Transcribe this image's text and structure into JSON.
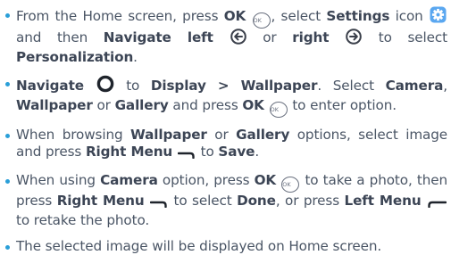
{
  "steps": [
    {
      "t1": "From the Home screen, press ",
      "ok": "OK",
      "ok_icon_text": "OK",
      "t2": ", select ",
      "settings": "Settings",
      "t3": " icon ",
      "t4": " and then ",
      "nav_left": "Navigate left",
      "t5": " or ",
      "right": "right",
      "t6": " to select ",
      "personalization": "Personalization",
      "t7": "."
    },
    {
      "navigate": "Navigate",
      "t1": " to ",
      "display_wallpaper": "Display > Wallpaper",
      "t2": ". Select ",
      "camera": "Camera",
      "t3": ", ",
      "wallpaper": "Wallpaper",
      "t4": " or ",
      "gallery": "Gallery",
      "t5": " and press ",
      "ok": "OK",
      "ok_icon_text": "OK",
      "t6": " to enter option."
    },
    {
      "t1": "When browsing ",
      "wallpaper": "Wallpaper",
      "t2": " or ",
      "gallery": "Gallery",
      "t3": " options, select image and press ",
      "right_menu": "Right Menu",
      "t4": " to ",
      "save": "Save",
      "t5": "."
    },
    {
      "t1": "When using ",
      "camera": "Camera",
      "t2": " option, press ",
      "ok": "OK",
      "ok_icon_text": "OK",
      "t3": " to take a photo, then press ",
      "right_menu": "Right Menu",
      "t4": " to select ",
      "done": "Done",
      "t5": ",  or press ",
      "left_menu": "Left Menu",
      "t6": " to retake the photo."
    },
    {
      "t1": "The selected image will be displayed on Home screen."
    }
  ],
  "icons": {
    "ok": "ok-button-icon",
    "settings": "settings-gear-icon",
    "nav_left": "navigate-left-icon",
    "nav_right": "navigate-right-icon",
    "navigate": "navigation-ring-icon",
    "right_menu": "right-menu-key-icon",
    "left_menu": "left-menu-key-icon"
  },
  "colors": {
    "text": "#4a5565",
    "bold_text": "#3c4555",
    "bullet": "#2a9fd8",
    "settings_icon_bg": "#5aa7f0",
    "icon_stroke": "#3a3f4a"
  }
}
